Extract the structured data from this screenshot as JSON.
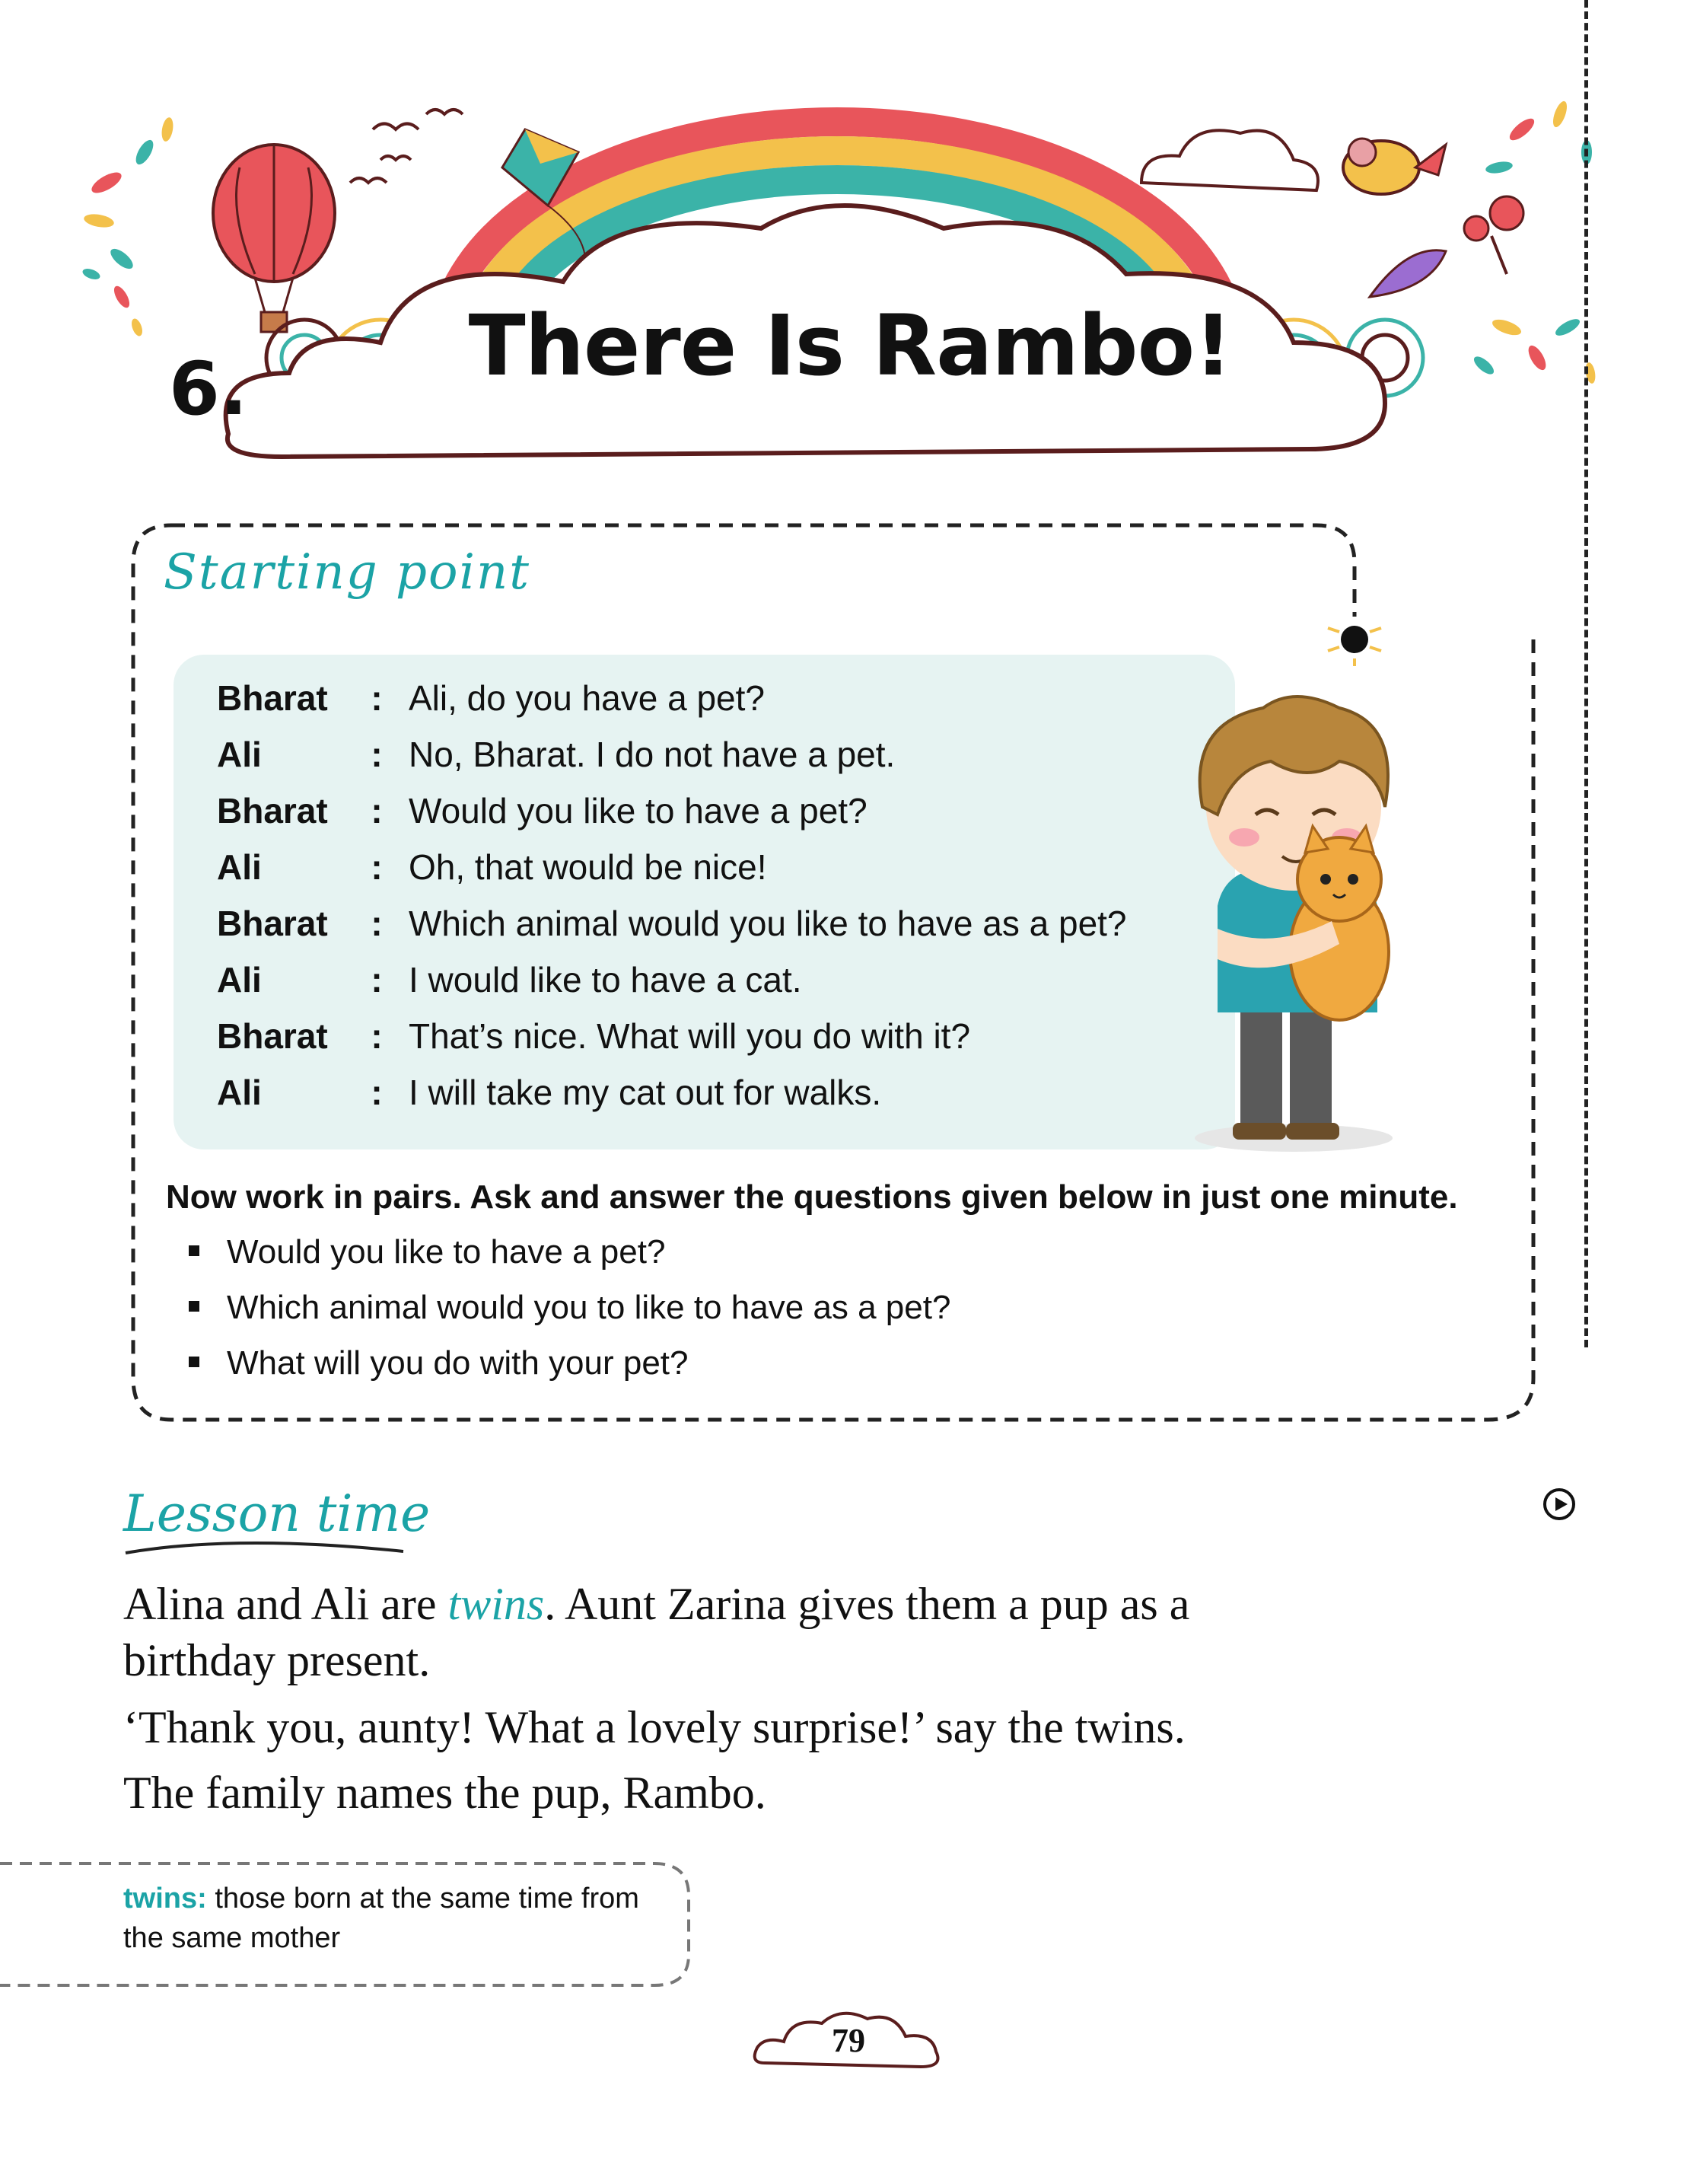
{
  "chapter": {
    "number": "6.",
    "title": "There Is Rambo!"
  },
  "starting_point": {
    "heading": "Starting point",
    "dialogue": [
      {
        "speaker": "Bharat",
        "colon": ":",
        "line": "Ali, do you have a pet?"
      },
      {
        "speaker": "Ali",
        "colon": ":",
        "line": "No, Bharat. I do not have a pet."
      },
      {
        "speaker": "Bharat",
        "colon": ":",
        "line": "Would you like to have a pet?"
      },
      {
        "speaker": "Ali",
        "colon": ":",
        "line": "Oh, that would be nice!"
      },
      {
        "speaker": "Bharat",
        "colon": ":",
        "line": "Which animal would you like to have as a pet?"
      },
      {
        "speaker": "Ali",
        "colon": ":",
        "line": "I would like to have a cat."
      },
      {
        "speaker": "Bharat",
        "colon": ":",
        "line": "That’s nice. What will you do with it?"
      },
      {
        "speaker": "Ali",
        "colon": ":",
        "line": "I will take my cat out for walks."
      }
    ],
    "instruction": "Now work in pairs. Ask and answer the questions given below in just one minute.",
    "questions": [
      "Would you like to have a pet?",
      "Which animal would you to like to have as a pet?",
      "What will you do with your pet?"
    ]
  },
  "lesson": {
    "heading": "Lesson time",
    "para1_before": "Alina and Ali are ",
    "para1_word": "twins",
    "para1_after": ". Aunt Zarina gives them a pup as a",
    "para1_line2": "birthday present.",
    "para2": "‘Thank you, aunty! What a lovely surprise!’ say the twins.",
    "para3": "The family names the pup, Rambo."
  },
  "glossary": {
    "term": "twins:",
    "definition": " those born at the same time from the same mother"
  },
  "page_number": "79",
  "colors": {
    "accent": "#1ba3a6",
    "panel": "#e6f3f2",
    "rainbow_red": "#e8555b",
    "rainbow_yellow": "#f3c14b",
    "rainbow_teal": "#3bb3a8"
  },
  "icons": [
    "hot-air-balloon-icon",
    "kite-icon",
    "rainbow-icon",
    "cloud-icon",
    "bird-icon",
    "flower-icon",
    "feather-icon",
    "play-icon",
    "boy-with-cat-illustration"
  ]
}
